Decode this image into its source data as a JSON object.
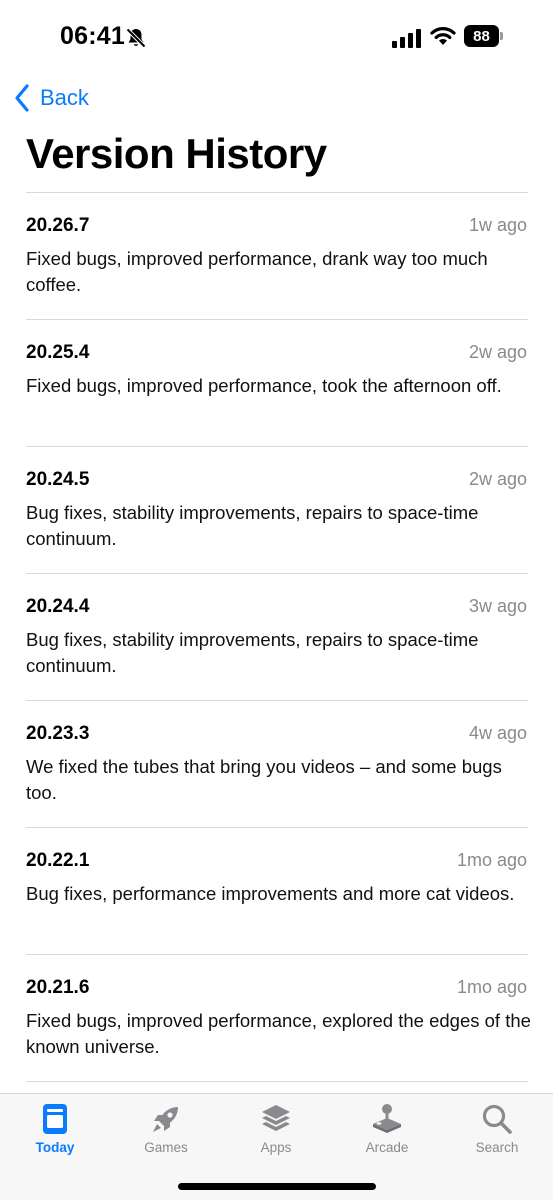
{
  "status_bar": {
    "time": "06:41",
    "battery": "88",
    "icons": [
      "bell-slash-icon",
      "cellular-signal-icon",
      "wifi-icon",
      "battery-icon"
    ]
  },
  "nav": {
    "back_label": "Back",
    "back_icon": "chevron-left-icon"
  },
  "page": {
    "title": "Version History"
  },
  "versions": [
    {
      "number": "20.26.7",
      "date": "1w ago",
      "notes": "Fixed bugs, improved performance, drank way too much coffee."
    },
    {
      "number": "20.25.4",
      "date": "2w ago",
      "notes": "Fixed bugs, improved performance, took the afternoon off."
    },
    {
      "number": "20.24.5",
      "date": "2w ago",
      "notes": "Bug fixes, stability improvements, repairs to space-time continuum."
    },
    {
      "number": "20.24.4",
      "date": "3w ago",
      "notes": "Bug fixes, stability improvements, repairs to space-time continuum."
    },
    {
      "number": "20.23.3",
      "date": "4w ago",
      "notes": "We fixed the tubes that bring you videos – and some bugs too."
    },
    {
      "number": "20.22.1",
      "date": "1mo ago",
      "notes": "Bug fixes, performance improvements and more cat videos."
    },
    {
      "number": "20.21.6",
      "date": "1mo ago",
      "notes": "Fixed bugs, improved performance, explored the edges of the known universe."
    }
  ],
  "tab_bar": {
    "tabs": [
      {
        "label": "Today",
        "icon": "today-icon",
        "active": true
      },
      {
        "label": "Games",
        "icon": "rocket-icon",
        "active": false
      },
      {
        "label": "Apps",
        "icon": "layers-icon",
        "active": false
      },
      {
        "label": "Arcade",
        "icon": "joystick-icon",
        "active": false
      },
      {
        "label": "Search",
        "icon": "search-icon",
        "active": false
      }
    ]
  },
  "colors": {
    "accent": "#0a7aff",
    "secondary_text": "#8a8a8e",
    "divider": "#d9d9dc",
    "tab_bar_bg": "#f7f7f7"
  }
}
